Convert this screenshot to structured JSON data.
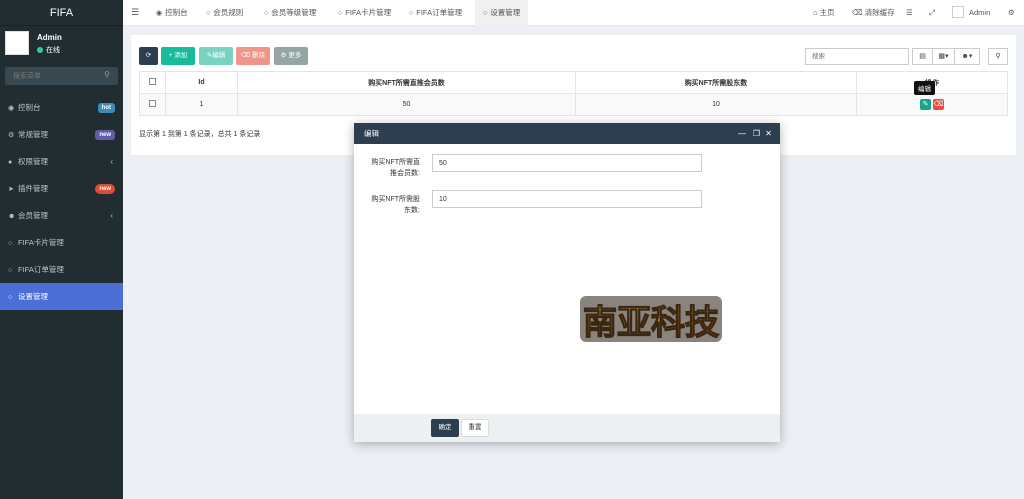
{
  "sidebar": {
    "brand": "FIFA",
    "user": {
      "name": "Admin",
      "status": "在线"
    },
    "search_placeholder": "搜索菜单",
    "items": [
      {
        "label": "控制台",
        "icon": "dashboard-icon",
        "badge": "hot"
      },
      {
        "label": "常规管理",
        "icon": "cogs-icon",
        "badge": "new"
      },
      {
        "label": "权限管理",
        "icon": "group-icon",
        "chevron": "‹"
      },
      {
        "label": "插件管理",
        "icon": "rocket-icon",
        "badge": "new"
      },
      {
        "label": "会员管理",
        "icon": "user-circle-icon",
        "chevron": "‹"
      },
      {
        "label": "FIFA卡片管理",
        "icon": "circle-icon"
      },
      {
        "label": "FIFA订单管理",
        "icon": "circle-icon"
      },
      {
        "label": "设置管理",
        "icon": "circle-icon",
        "active": true
      }
    ]
  },
  "topbar": {
    "tabs": [
      {
        "label": "控制台",
        "icon": "dashboard-icon"
      },
      {
        "label": "会员规则",
        "icon": "circle-icon"
      },
      {
        "label": "会员等级管理",
        "icon": "circle-icon"
      },
      {
        "label": "FIFA卡片管理",
        "icon": "circle-icon"
      },
      {
        "label": "FIFA订单管理",
        "icon": "circle-icon"
      },
      {
        "label": "设置管理",
        "icon": "circle-icon",
        "active": true
      }
    ],
    "home": "主页",
    "clear_cache": "清除缓存",
    "admin": "Admin"
  },
  "toolbar": {
    "add": "添加",
    "edit": "编辑",
    "delete": "删除",
    "more": "更多",
    "search_placeholder": "搜索"
  },
  "table": {
    "headers": [
      "Id",
      "购买NFT所需直推会员数",
      "购买NFT所需股东数",
      "操作"
    ],
    "rows": [
      {
        "id": "1",
        "direct_members": "50",
        "shareholders": "10"
      }
    ],
    "tooltip": "编辑",
    "pager": "显示第 1 到第 1 条记录，总共 1 条记录"
  },
  "modal": {
    "title": "编辑",
    "fields": [
      {
        "label_line1": "购买NFT所需直",
        "label_line2": "推会员数:",
        "value": "50"
      },
      {
        "label_line1": "购买NFT所需股",
        "label_line2": "东数:",
        "value": "10"
      }
    ],
    "ok": "确定",
    "reset": "重置",
    "watermark": "南亚科技"
  },
  "colors": {
    "sidebar_bg": "#222d32",
    "active_menu": "#4c6ed7",
    "primary": "#2c3e50",
    "success": "#18bc9c",
    "danger": "#e74c3c"
  }
}
